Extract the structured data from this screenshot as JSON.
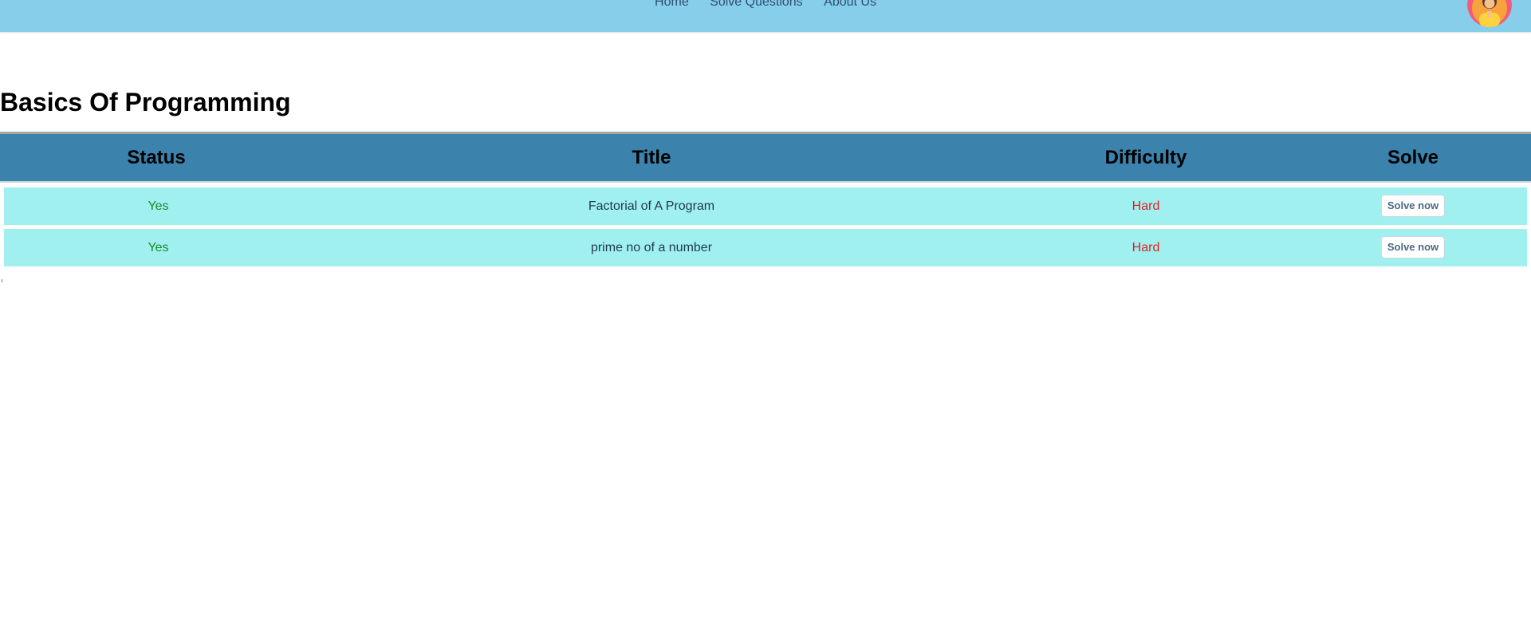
{
  "nav": {
    "links": [
      {
        "label": "Home"
      },
      {
        "label": "Solve Questions"
      },
      {
        "label": "About Us"
      }
    ],
    "avatar_icon": "user-avatar-icon",
    "bar_color": "#87ceeb"
  },
  "page": {
    "title": "Basics Of Programming"
  },
  "table": {
    "header_color": "#3b82ad",
    "row_color": "#a0f0f0",
    "columns": [
      "Status",
      "Title",
      "Difficulty",
      "Solve"
    ],
    "rows": [
      {
        "status": "Yes",
        "title": "Factorial of A Program",
        "difficulty": "Hard",
        "action": "Solve now"
      },
      {
        "status": "Yes",
        "title": "prime no of a number",
        "difficulty": "Hard",
        "action": "Solve now"
      }
    ],
    "status_color": "#1a8a2a",
    "difficulty_color": "#e02020"
  }
}
